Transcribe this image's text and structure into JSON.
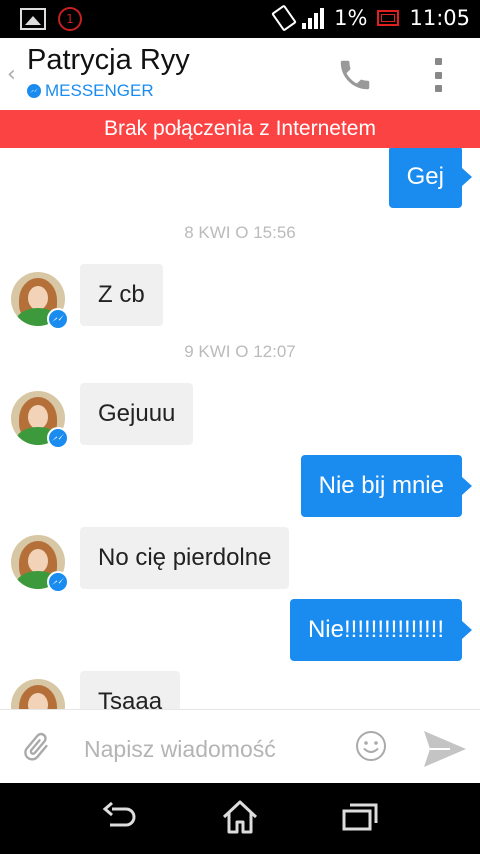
{
  "status_bar": {
    "notification_count": "1",
    "battery_percent": "1%",
    "time": "11:05"
  },
  "header": {
    "contact_name": "Patrycja Ryy",
    "app_label": "MESSENGER"
  },
  "banner": {
    "text": "Brak połączenia z Internetem"
  },
  "messages": [
    {
      "type": "out",
      "text": "Gej"
    },
    {
      "type": "timestamp",
      "text": "8 KWI O 15:56"
    },
    {
      "type": "in",
      "text": "Z cb"
    },
    {
      "type": "timestamp",
      "text": "9 KWI O 12:07"
    },
    {
      "type": "in",
      "text": "Gejuuu"
    },
    {
      "type": "out",
      "text": "Nie bij mnie"
    },
    {
      "type": "in",
      "text": "No cię pierdolne"
    },
    {
      "type": "out",
      "text": "Nie!!!!!!!!!!!!!!!"
    },
    {
      "type": "in",
      "text": "Tsaaa"
    }
  ],
  "composer": {
    "placeholder": "Napisz wiadomość"
  },
  "colors": {
    "accent": "#1a8cf0",
    "banner": "#fc4343",
    "incoming_bubble": "#f0f0f0"
  }
}
